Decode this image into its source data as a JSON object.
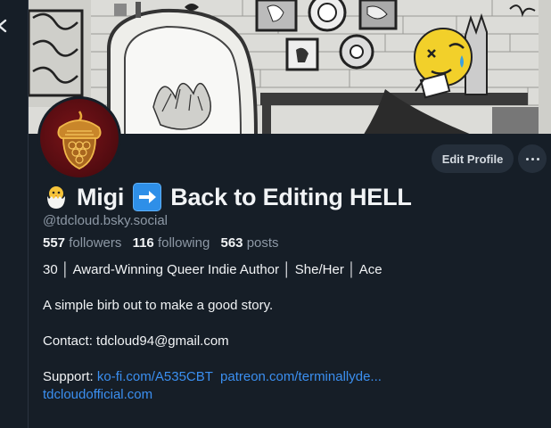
{
  "profile": {
    "display_name_text": "Migi",
    "display_name_suffix": "Back to Editing HELL",
    "handle": "@tdcloud.bsky.social",
    "followers_count": "557",
    "followers_label": "followers",
    "following_count": "116",
    "following_label": "following",
    "posts_count": "563",
    "posts_label": "posts"
  },
  "actions": {
    "edit_profile_label": "Edit Profile"
  },
  "bio": {
    "line1": "30 │ Award-Winning Queer Indie Author │ She/Her │ Ace",
    "line2": "A simple birb out to make a good story.",
    "line3": "Contact: tdcloud94@gmail.com",
    "support_label": "Support:",
    "link_kofi": "ko-fi.com/A535CBT",
    "link_patreon": "patreon.com/terminallyde...",
    "link_site": "tdcloudofficial.com"
  },
  "icons": {
    "back": "chevron-left-icon",
    "more": "ellipsis-icon",
    "chick": "hatching-chick-emoji",
    "arrow": "right-arrow-emoji"
  },
  "colors": {
    "background": "#161e27",
    "link": "#3b8ff0",
    "muted": "#8d98a5",
    "button": "#252f3b"
  }
}
